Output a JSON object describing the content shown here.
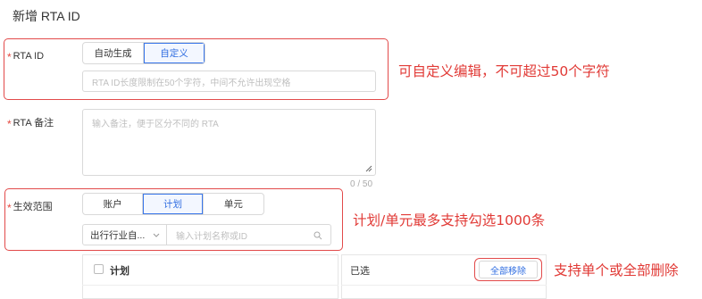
{
  "page": {
    "title": "新增 RTA ID"
  },
  "rta_id": {
    "required_mark": "*",
    "label": "RTA ID",
    "options": [
      "自动生成",
      "自定义"
    ],
    "selected_index": 1,
    "input_placeholder": "RTA ID长度限制在50个字符，中间不允许出现空格"
  },
  "rta_note": {
    "required_mark": "*",
    "label": "RTA 备注",
    "placeholder": "输入备注，便于区分不同的 RTA",
    "counter": "0 / 50"
  },
  "scope": {
    "required_mark": "*",
    "label": "生效范围",
    "options": [
      "账户",
      "计划",
      "单元"
    ],
    "selected_index": 1,
    "filter_value": "出行行业自...",
    "search_placeholder": "输入计划名称或ID"
  },
  "transfer": {
    "left_header": "计划",
    "right_header": "已选",
    "remove_all_label": "全部移除"
  },
  "annotations": {
    "rta_id_note": "可自定义编辑，不可超过50个字符",
    "scope_note": "计划/单元最多支持勾选1000条",
    "remove_note": "支持单个或全部删除"
  },
  "colors": {
    "accent": "#2f6de1",
    "required": "#e5483f",
    "annotation": "#e13a36"
  }
}
